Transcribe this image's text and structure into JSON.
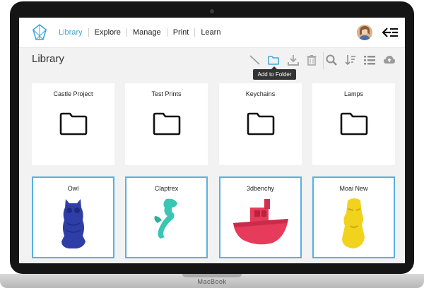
{
  "nav": {
    "items": [
      {
        "label": "Library",
        "active": true
      },
      {
        "label": "Explore",
        "active": false
      },
      {
        "label": "Manage",
        "active": false
      },
      {
        "label": "Print",
        "active": false
      },
      {
        "label": "Learn",
        "active": false
      }
    ]
  },
  "page": {
    "title": "Library",
    "tooltip": "Add to Folder"
  },
  "toolbar": {
    "icons": [
      "edit-icon",
      "folder-icon",
      "download-icon",
      "trash-icon",
      "search-icon",
      "sort-icon",
      "list-view-icon",
      "cloud-upload-icon"
    ]
  },
  "folders": [
    {
      "label": "Castle Project"
    },
    {
      "label": "Test Prints"
    },
    {
      "label": "Keychains"
    },
    {
      "label": "Lamps"
    }
  ],
  "models": [
    {
      "label": "Owl",
      "color": "#2e3ea6"
    },
    {
      "label": "Claptrex",
      "color": "#39c6b3"
    },
    {
      "label": "3dbenchy",
      "color": "#e63b5a"
    },
    {
      "label": "Moai New",
      "color": "#f1d21c"
    }
  ],
  "colors": {
    "accent": "#3fa7d6",
    "model_border": "#56b2e0"
  },
  "device": {
    "label": "MacBook"
  }
}
